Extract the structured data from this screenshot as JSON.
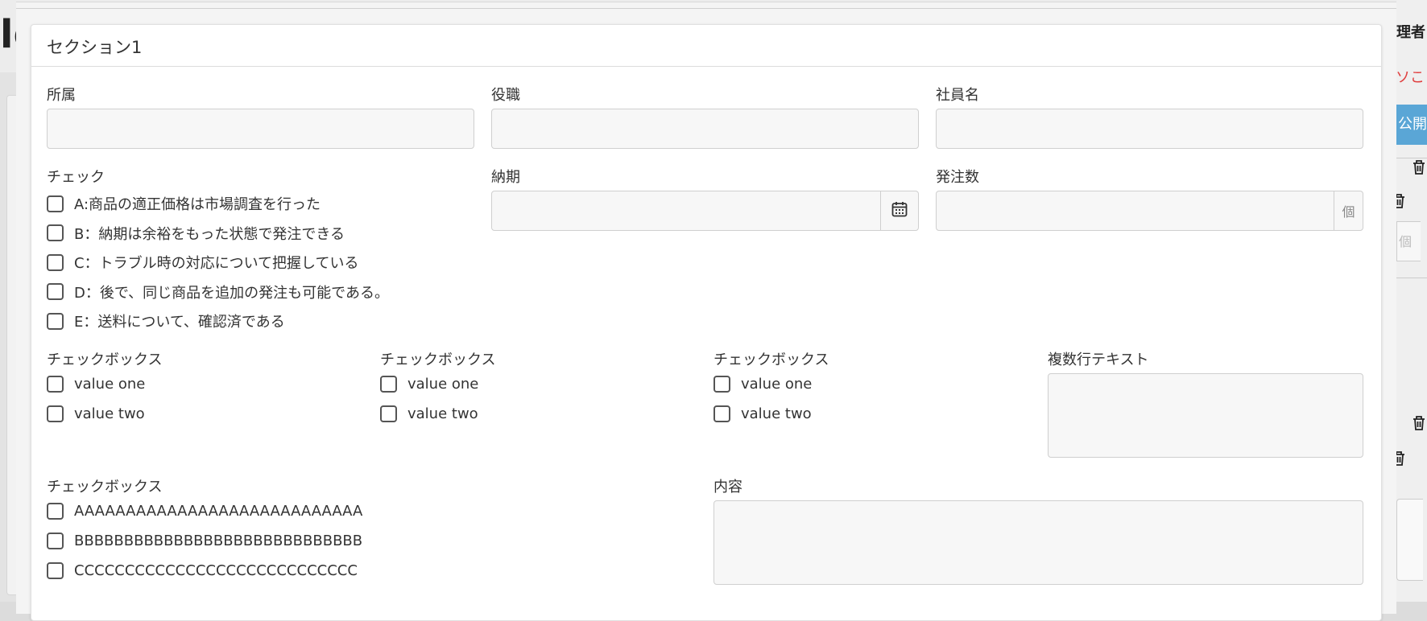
{
  "background": {
    "logo_fragment": "lg",
    "right_header_text": "理者",
    "right_red_text": "ソこト",
    "right_button": "公開",
    "right_input_unit": "個"
  },
  "section": {
    "title": "セクション1"
  },
  "fields": {
    "affiliation": {
      "label": "所属",
      "value": ""
    },
    "position": {
      "label": "役職",
      "value": ""
    },
    "employee_name": {
      "label": "社員名",
      "value": ""
    },
    "delivery_date": {
      "label": "納期",
      "value": "",
      "icon": "calendar-icon"
    },
    "order_qty": {
      "label": "発注数",
      "value": "",
      "unit": "個"
    }
  },
  "check_group": {
    "label": "チェック",
    "options": [
      {
        "label": "A:商品の適正価格は市場調査を行った",
        "checked": false
      },
      {
        "label": "B：納期は余裕をもった状態で発注できる",
        "checked": false
      },
      {
        "label": "C：トラブル時の対応について把握している",
        "checked": false
      },
      {
        "label": "D：後で、同じ商品を追加の発注も可能である。",
        "checked": false
      },
      {
        "label": "E：送料について、確認済である",
        "checked": false
      }
    ]
  },
  "checkbox_groups": [
    {
      "label": "チェックボックス",
      "options": [
        "value one",
        "value two"
      ]
    },
    {
      "label": "チェックボックス",
      "options": [
        "value one",
        "value two"
      ]
    },
    {
      "label": "チェックボックス",
      "options": [
        "value one",
        "value two"
      ]
    }
  ],
  "multiline_text": {
    "label": "複数行テキスト",
    "value": ""
  },
  "checkbox_group_long": {
    "label": "チェックボックス",
    "options": [
      "AAAAAAAAAAAAAAAAAAAAAAAAAAAA",
      "BBBBBBBBBBBBBBBBBBBBBBBBBBBBB",
      "CCCCCCCCCCCCCCCCCCCCCCCCCCCC"
    ]
  },
  "content": {
    "label": "内容",
    "value": ""
  }
}
